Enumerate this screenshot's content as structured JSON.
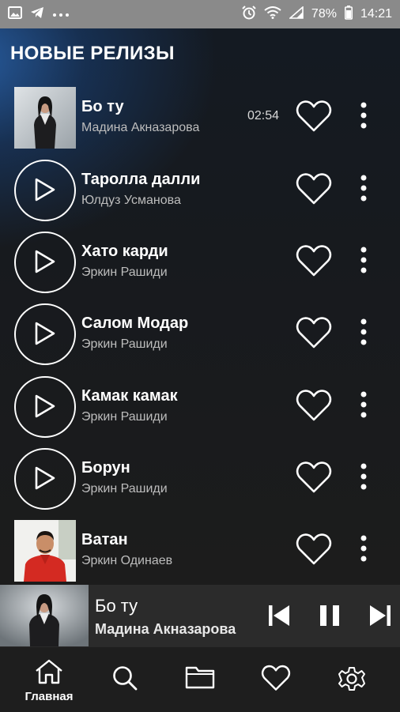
{
  "status_bar": {
    "battery": "78%",
    "time": "14:21",
    "left_icons": [
      "image-icon",
      "telegram-icon",
      "more-dots-icon"
    ],
    "right_icons": [
      "alarm-icon",
      "wifi-icon",
      "signal-icon",
      "battery-icon"
    ]
  },
  "section": {
    "title": "НОВЫЕ РЕЛИЗЫ"
  },
  "tracks": [
    {
      "title": "Бо ту",
      "artist": "Мадина Акназарова",
      "duration": "02:54",
      "cover": "photo"
    },
    {
      "title": "Таролла далли",
      "artist": "Юлдуз Усманова",
      "cover": "play"
    },
    {
      "title": "Хато карди",
      "artist": "Эркин Рашиди",
      "cover": "play"
    },
    {
      "title": "Салом Модар",
      "artist": "Эркин Рашиди",
      "cover": "play"
    },
    {
      "title": "Камак камак",
      "artist": "Эркин Рашиди",
      "cover": "play"
    },
    {
      "title": "Борун",
      "artist": "Эркин Рашиди",
      "cover": "play"
    },
    {
      "title": "Ватан",
      "artist": "Эркин Одинаев",
      "cover": "photo"
    }
  ],
  "player": {
    "title": "Бо ту",
    "artist": "Мадина Акназарова",
    "state": "playing"
  },
  "nav": [
    {
      "icon": "home-icon",
      "label": "Главная",
      "active": true
    },
    {
      "icon": "search-icon",
      "label": ""
    },
    {
      "icon": "folder-icon",
      "label": ""
    },
    {
      "icon": "heart-icon",
      "label": ""
    },
    {
      "icon": "settings-icon",
      "label": ""
    }
  ],
  "colors": {
    "accent_glow": "#285fa5",
    "background": "#1a1a1a",
    "player_bg": "#2b2b2b"
  }
}
